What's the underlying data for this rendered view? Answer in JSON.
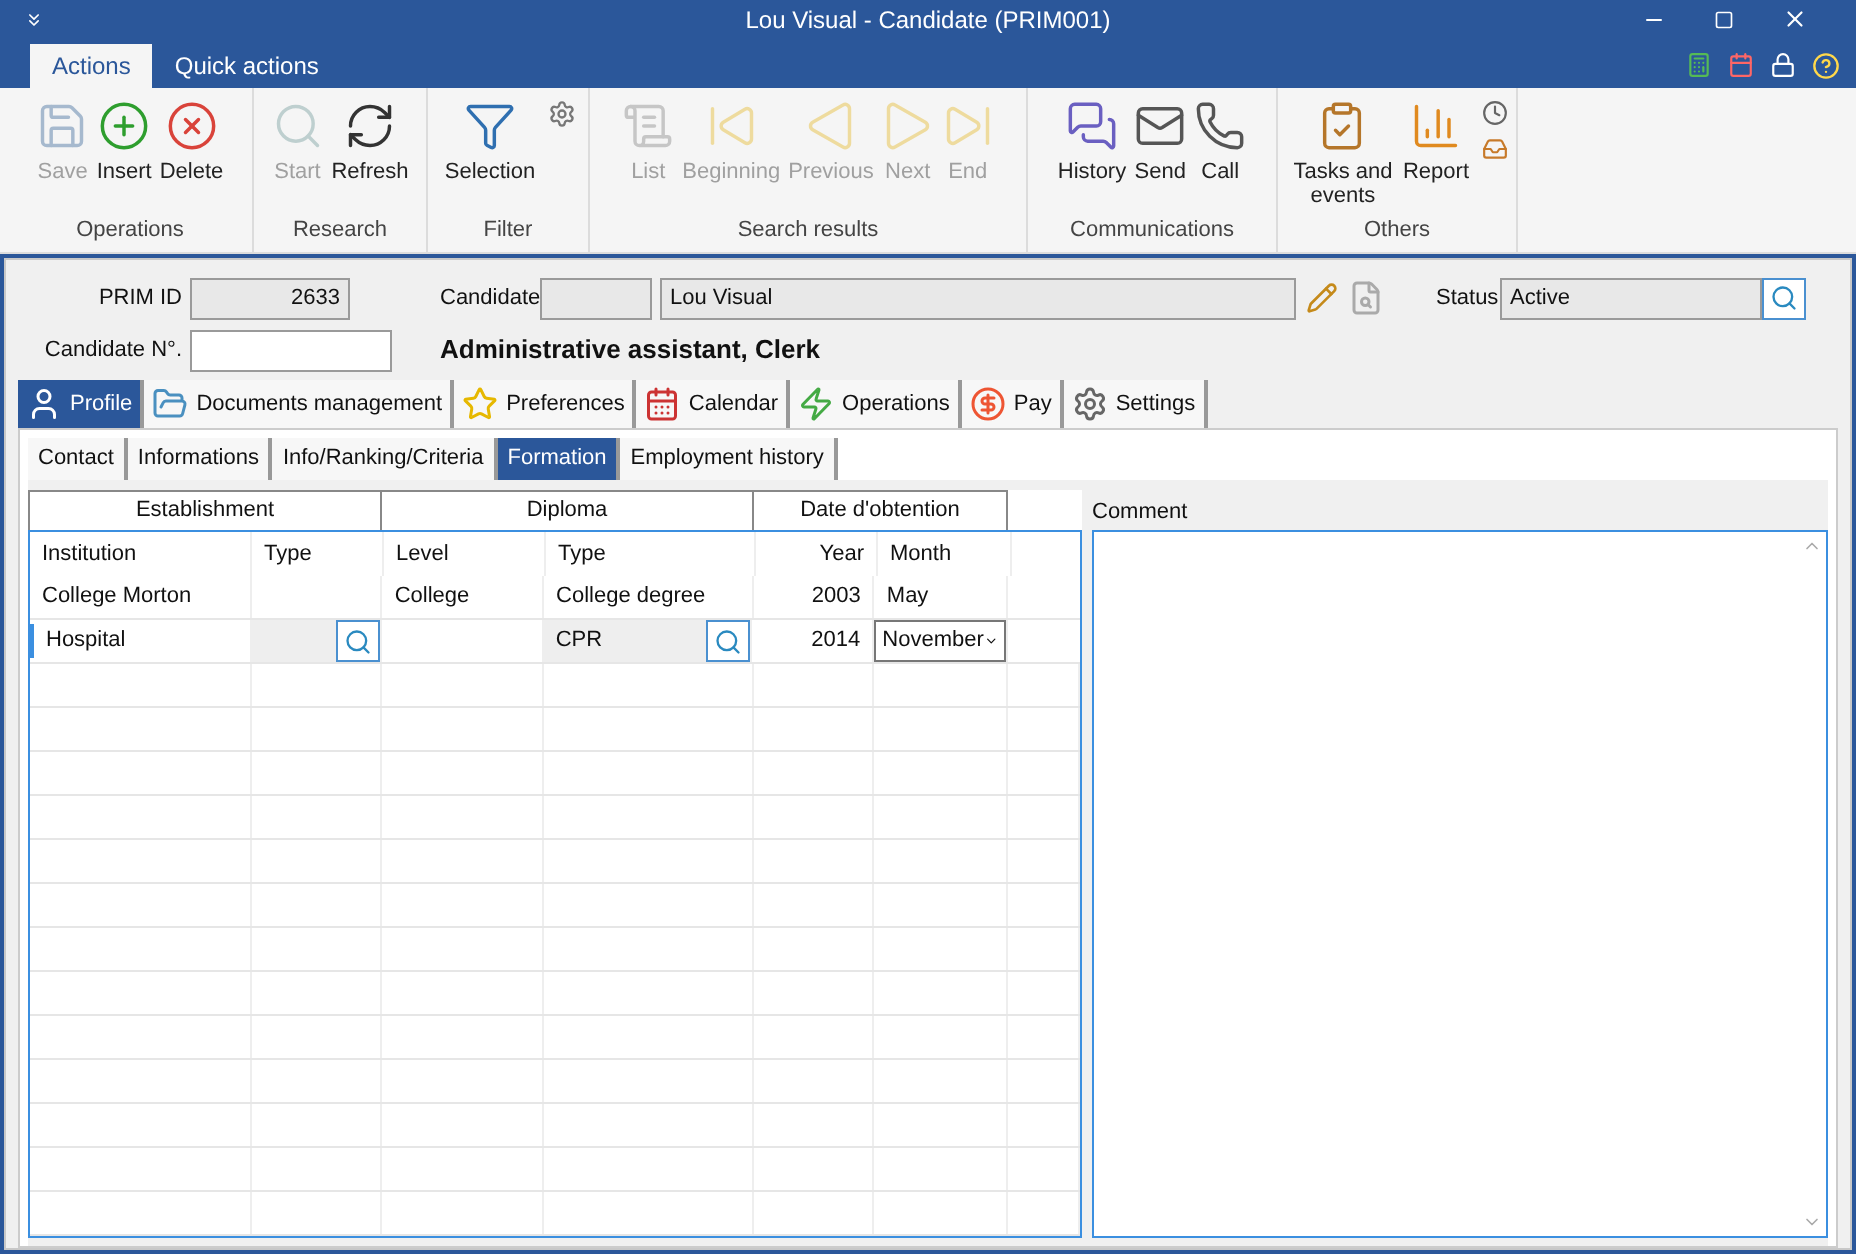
{
  "window": {
    "title": "Lou Visual - Candidate (PRIM001)"
  },
  "ribbon_tabs": [
    {
      "label": "Actions",
      "selected": true
    },
    {
      "label": "Quick actions",
      "selected": false
    }
  ],
  "ribbon_groups": [
    {
      "title": "Operations",
      "buttons": [
        {
          "label": "Save",
          "disabled": true
        },
        {
          "label": "Insert",
          "disabled": false
        },
        {
          "label": "Delete",
          "disabled": false
        }
      ]
    },
    {
      "title": "Research",
      "buttons": [
        {
          "label": "Start",
          "disabled": true
        },
        {
          "label": "Refresh",
          "disabled": false
        }
      ]
    },
    {
      "title": "Filter",
      "buttons": [
        {
          "label": "Selection",
          "disabled": false
        }
      ]
    },
    {
      "title": "Search results",
      "buttons": [
        {
          "label": "List",
          "disabled": true
        },
        {
          "label": "Beginning",
          "disabled": true
        },
        {
          "label": "Previous",
          "disabled": true
        },
        {
          "label": "Next",
          "disabled": true
        },
        {
          "label": "End",
          "disabled": true
        }
      ]
    },
    {
      "title": "Communications",
      "buttons": [
        {
          "label": "History",
          "disabled": false
        },
        {
          "label": "Send",
          "disabled": false
        },
        {
          "label": "Call",
          "disabled": false
        }
      ]
    },
    {
      "title": "Others",
      "buttons": [
        {
          "label": "Tasks and events",
          "disabled": false
        },
        {
          "label": "Report",
          "disabled": false
        }
      ]
    }
  ],
  "form": {
    "prim_id": {
      "label": "PRIM ID",
      "value": "2633"
    },
    "candidate": {
      "label": "Candidate",
      "value": "Lou Visual"
    },
    "status": {
      "label": "Status",
      "value": "Active"
    },
    "candidate_no": {
      "label": "Candidate N°."
    },
    "position": "Administrative assistant, Clerk"
  },
  "tabs": [
    {
      "label": "Profile",
      "selected": true
    },
    {
      "label": "Documents management",
      "selected": false
    },
    {
      "label": "Preferences",
      "selected": false
    },
    {
      "label": "Calendar",
      "selected": false
    },
    {
      "label": "Operations",
      "selected": false
    },
    {
      "label": "Pay",
      "selected": false
    },
    {
      "label": "Settings",
      "selected": false
    }
  ],
  "subtabs": [
    {
      "label": "Contact",
      "selected": false
    },
    {
      "label": "Informations",
      "selected": false
    },
    {
      "label": "Info/Ranking/Criteria",
      "selected": false
    },
    {
      "label": "Formation",
      "selected": true
    },
    {
      "label": "Employment history",
      "selected": false
    }
  ],
  "table": {
    "groups": [
      "Establishment",
      "Diploma",
      "Date d'obtention"
    ],
    "columns": [
      "Institution",
      "Type",
      "Level",
      "Type",
      "Year",
      "Month"
    ],
    "rows": [
      {
        "institution": "College Morton",
        "type": "",
        "level": "College",
        "diploma_type": "College degree",
        "year": "2003",
        "month": "May",
        "editing": false
      },
      {
        "institution": "Hospital",
        "type": "",
        "level": "",
        "diploma_type": "CPR",
        "year": "2014",
        "month": "November",
        "editing": true
      }
    ]
  },
  "comment": {
    "label": "Comment"
  }
}
